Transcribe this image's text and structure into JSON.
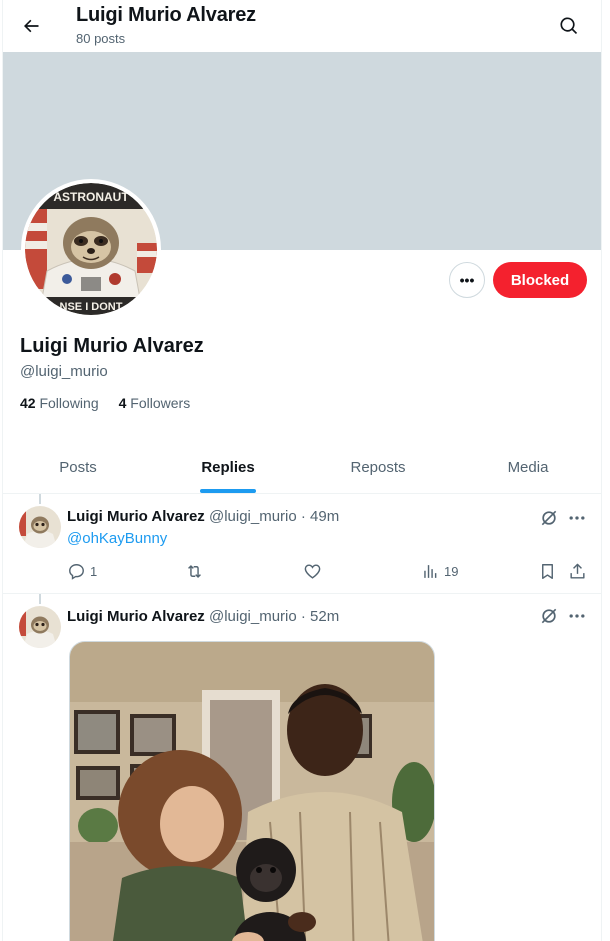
{
  "header": {
    "title": "Luigi Murio Alvarez",
    "post_count": "80 posts"
  },
  "profile": {
    "avatar_text_top": "ASTRONAUT",
    "avatar_text_bottom": "NSE I DONT",
    "name": "Luigi Murio Alvarez",
    "handle": "@luigi_murio",
    "following_count": "42",
    "following_label": "Following",
    "followers_count": "4",
    "followers_label": "Followers",
    "more_label": "•••",
    "blocked_label": "Blocked",
    "banner_color": "#cfd9de"
  },
  "tabs": [
    {
      "label": "Posts",
      "active": false
    },
    {
      "label": "Replies",
      "active": true
    },
    {
      "label": "Reposts",
      "active": false
    },
    {
      "label": "Media",
      "active": false
    }
  ],
  "posts": [
    {
      "name": "Luigi Murio Alvarez",
      "meta": "@luigi_murio · 49m",
      "mention": "@ohKayBunny",
      "replies": "1",
      "views": "19"
    },
    {
      "name": "Luigi Murio Alvarez",
      "meta": "@luigi_murio · 52m"
    }
  ],
  "colors": {
    "accent": "#1d9bf0",
    "blocked": "#f4212e",
    "muted": "#536471"
  }
}
